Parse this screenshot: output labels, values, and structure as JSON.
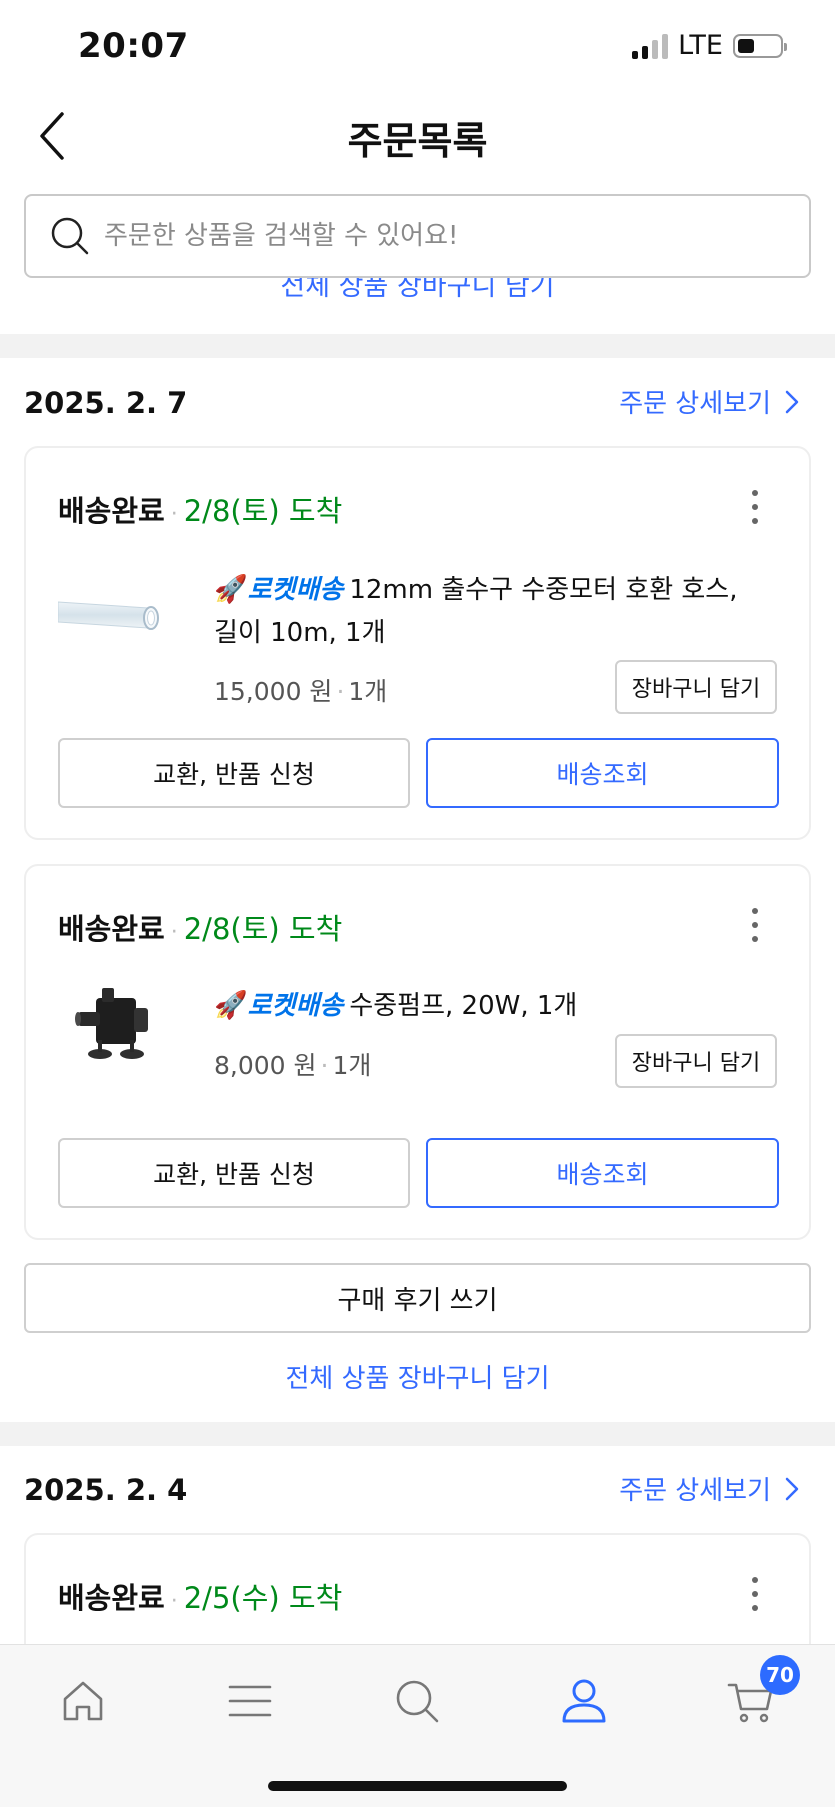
{
  "status_bar": {
    "time": "20:07",
    "network": "LTE"
  },
  "nav": {
    "title": "주문목록"
  },
  "search": {
    "placeholder": "주문한 상품을 검색할 수 있어요!"
  },
  "peek_link": "전체 상품 장바구니 담기",
  "orders": [
    {
      "date": "2025. 2. 7",
      "detail_link": "주문 상세보기",
      "shipments": [
        {
          "status": "배송완료",
          "arrival": "2/8(토) 도착",
          "badge": "로켓배송",
          "product_name": "12mm 출수구 수중모터 호환 호스, 길이 10m, 1개",
          "price": "15,000 원",
          "qty": "1개",
          "cart_button": "장바구니 담기",
          "exchange_button": "교환, 반품 신청",
          "track_button": "배송조회"
        },
        {
          "status": "배송완료",
          "arrival": "2/8(토) 도착",
          "badge": "로켓배송",
          "product_name": "수중펌프, 20W, 1개",
          "price": "8,000 원",
          "qty": "1개",
          "cart_button": "장바구니 담기",
          "exchange_button": "교환, 반품 신청",
          "track_button": "배송조회"
        }
      ],
      "review_button": "구매 후기 쓰기",
      "cart_all_link": "전체 상품 장바구니 담기"
    },
    {
      "date": "2025. 2. 4",
      "detail_link": "주문 상세보기",
      "shipments": [
        {
          "status": "배송완료",
          "arrival": "2/5(수) 도착"
        }
      ]
    }
  ],
  "tab_bar": {
    "items": [
      "home-icon",
      "menu-icon",
      "search-icon",
      "user-icon",
      "cart-icon"
    ],
    "active": "user-icon",
    "cart_badge": "70"
  },
  "colors": {
    "accent": "#346aff",
    "arrival_green": "#00891a",
    "rocket_blue": "#0073e9",
    "badge_blue": "#2d6bff"
  }
}
